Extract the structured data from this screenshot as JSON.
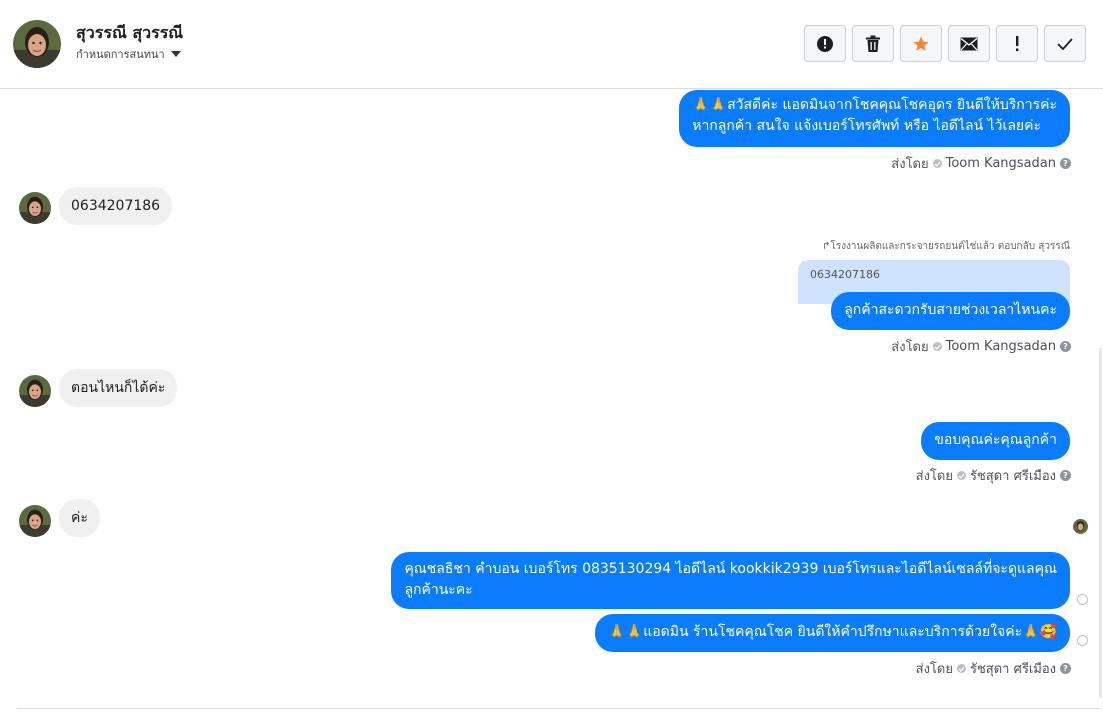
{
  "header": {
    "contact_name": "สุวรรณี สุวรรณี",
    "conversation_setting": "กำหนดการสนทนา",
    "toolbar": [
      {
        "name": "spam-button",
        "icon": "alert-circle-icon"
      },
      {
        "name": "delete-button",
        "icon": "trash-icon"
      },
      {
        "name": "star-button",
        "icon": "star-icon"
      },
      {
        "name": "mark-unread-button",
        "icon": "envelope-icon"
      },
      {
        "name": "follow-up-button",
        "icon": "exclamation-icon"
      },
      {
        "name": "done-button",
        "icon": "checkmark-icon"
      }
    ]
  },
  "colors": {
    "outgoing_bubble": "#0a7cff",
    "incoming_bubble": "#f0f0f0",
    "quoted_bubble": "#cfe3fd",
    "star": "#f5882a"
  },
  "messages": [
    {
      "id": "m1",
      "direction": "out",
      "lines": [
        "🙏🙏สวัสดีค่ะ แอดมินจากโชคคุณโชคอุดร ยินดีให้บริการค่ะ",
        "หากลูกค้า สนใจ แจ้งเบอร์โทรศัพท์ หรือ ไอดีไลน์  ไว้เลยค่ะ"
      ]
    },
    {
      "id": "m2",
      "direction": "in",
      "text": "0634207186"
    },
    {
      "id": "m3",
      "direction": "out",
      "reply_note": "โรงงานผลิตและกระจายรถยนต์ไช่แล้ว ตอบกลับ สุวรรณี",
      "quoted_text": "0634207186",
      "text": "ลูกค้าสะดวกรับสายช่วงเวลาไหนคะ"
    },
    {
      "id": "m4",
      "direction": "in",
      "text": "ตอนไหนก็ได้ค่ะ"
    },
    {
      "id": "m5",
      "direction": "out",
      "text": "ขอบคุณค่ะคุณลูกค้า"
    },
    {
      "id": "m6",
      "direction": "in",
      "text": "ค่ะ"
    },
    {
      "id": "m7",
      "direction": "out",
      "lines": [
        "คุณชลธิชา คำบอน เบอร์โทร 0835130294  ไอดีไลน์ kookkik2939  เบอร์โทรและไอดีไลน์เซลล์ที่จะดูแลคุณ",
        "ลูกค้านะคะ"
      ]
    },
    {
      "id": "m8",
      "direction": "out",
      "text": "🙏🙏แอดมิน ร้านโชคคุณโชค ยินดีให้คำปรึกษาและบริการด้วยใจค่ะ🙏🥰"
    }
  ],
  "sent_by": [
    {
      "label": "ส่งโดย",
      "agent": "Toom Kangsadan"
    },
    {
      "label": "ส่งโดย",
      "agent": "Toom Kangsadan"
    },
    {
      "label": "ส่งโดย",
      "agent": "รัชสุดา ศรีเมือง"
    },
    {
      "label": "ส่งโดย",
      "agent": "รัชสุดา ศรีเมือง"
    }
  ]
}
